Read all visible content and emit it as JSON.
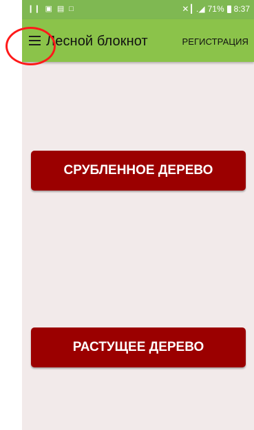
{
  "status_bar": {
    "left_icons": [
      "pause-icon",
      "screenshot-icon",
      "gallery-icon",
      "file-icon"
    ],
    "signal_text": "✕┃ .◢",
    "battery": "71%",
    "time": "8:37"
  },
  "app_bar": {
    "title": "Лесной блокнот",
    "action": "РЕГИСТРАЦИЯ",
    "color": "#8bc34a"
  },
  "buttons": {
    "cut_tree": "СРУБЛЕННОЕ ДЕРЕВО",
    "growing_tree": "РАСТУЩЕЕ ДЕРЕВО",
    "color": "#9b0000"
  },
  "annotation": {
    "color": "#ff1a1a"
  }
}
